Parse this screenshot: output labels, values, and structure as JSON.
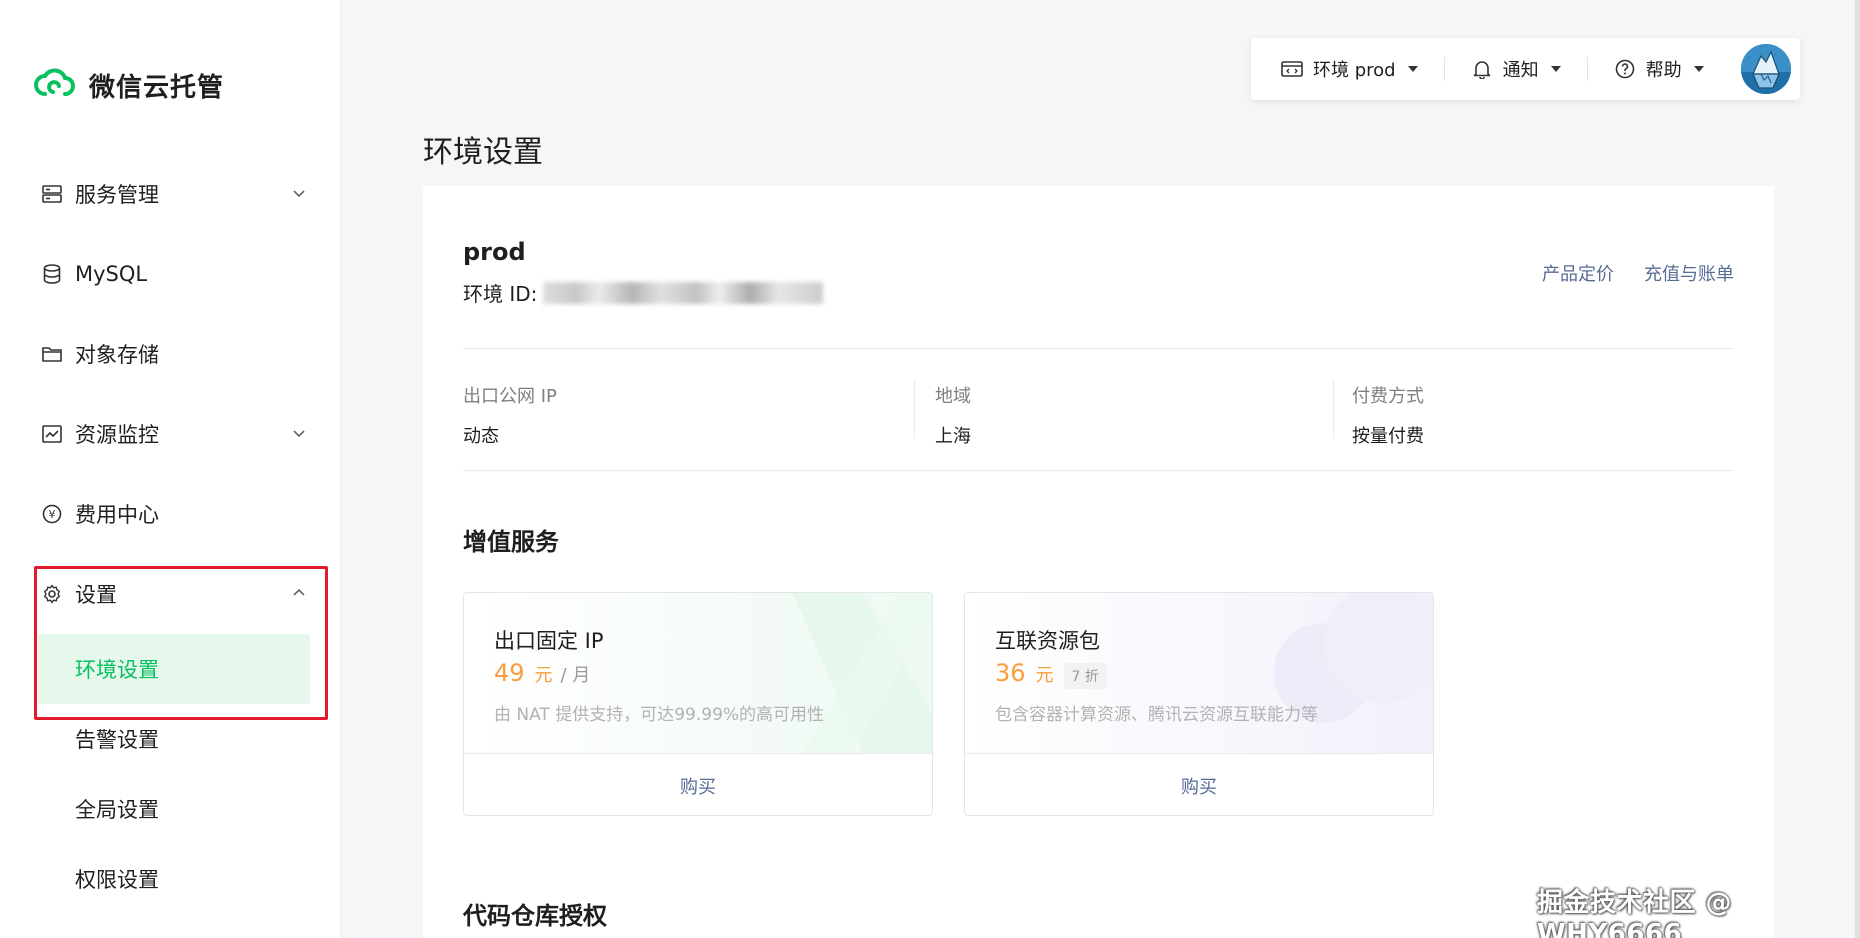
{
  "app": {
    "name": "微信云托管"
  },
  "sidebar": {
    "items": [
      {
        "label": "服务管理",
        "icon": "server-icon",
        "expandable": true
      },
      {
        "label": "MySQL",
        "icon": "database-icon"
      },
      {
        "label": "对象存储",
        "icon": "folder-icon"
      },
      {
        "label": "资源监控",
        "icon": "monitor-chart-icon",
        "expandable": true
      },
      {
        "label": "费用中心",
        "icon": "yen-icon"
      },
      {
        "label": "设置",
        "icon": "gear-icon",
        "expanded": true
      }
    ],
    "settings_sub": [
      {
        "label": "环境设置",
        "active": true
      },
      {
        "label": "告警设置"
      },
      {
        "label": "全局设置"
      },
      {
        "label": "权限设置"
      }
    ]
  },
  "topbar": {
    "env_label": "环境 prod",
    "notify_label": "通知",
    "help_label": "帮助"
  },
  "page": {
    "title": "环境设置"
  },
  "env": {
    "name": "prod",
    "id_label": "环境 ID:",
    "links": [
      "产品定价",
      "充值与账单"
    ],
    "info": [
      {
        "label": "出口公网 IP",
        "value": "动态"
      },
      {
        "label": "地域",
        "value": "上海"
      },
      {
        "label": "付费方式",
        "value": "按量付费"
      }
    ]
  },
  "value_added": {
    "title": "增值服务",
    "cards": [
      {
        "name": "出口固定 IP",
        "price": "49",
        "unit": "元",
        "per": "/ 月",
        "desc": "由 NAT 提供支持，可达99.99%的高可用性",
        "button": "购买"
      },
      {
        "name": "互联资源包",
        "price": "36",
        "unit": "元",
        "discount": "7 折",
        "desc": "包含容器计算资源、腾讯云资源互联能力等",
        "button": "购买"
      }
    ]
  },
  "code_repo": {
    "title": "代码仓库授权"
  },
  "watermark": "掘金技术社区 @ WHY6666",
  "colors": {
    "brand_green": "#07c160",
    "link_blue": "#576b95",
    "price_orange": "#fa9d3b",
    "highlight_red": "#e0192b"
  }
}
